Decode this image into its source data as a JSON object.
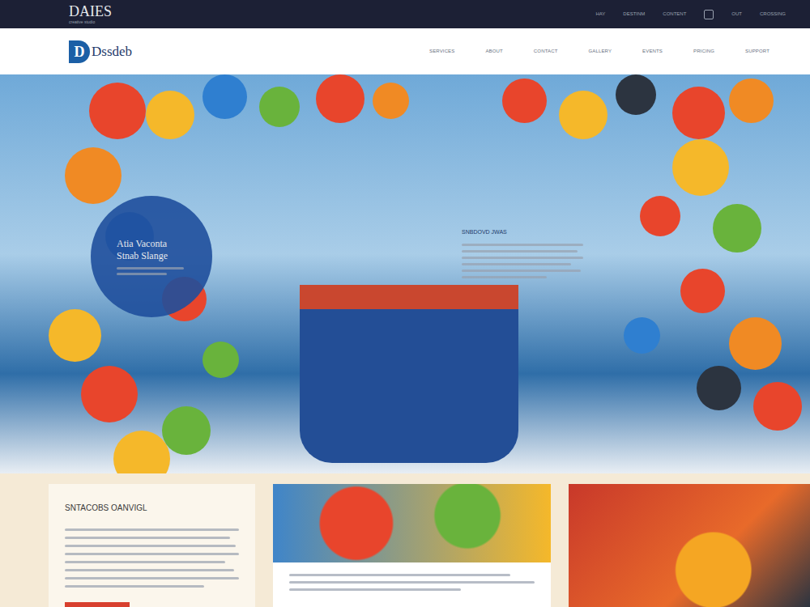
{
  "topbar": {
    "brand": "DAIES",
    "tagline": "creative studio",
    "links": [
      "HAY",
      "DESTINM",
      "CONTENT",
      "OUT",
      "CROSSING"
    ]
  },
  "header": {
    "logo_text": "Dssdeb",
    "logo_mark": "D",
    "nav": [
      "SERVICES",
      "ABOUT",
      "CONTACT",
      "GALLERY",
      "EVENTS",
      "PRICING",
      "SUPPORT"
    ]
  },
  "hero": {
    "badge_title": "Atia Vaconta",
    "badge_subtitle": "Stnab Slange",
    "heading": "SNBDOVD JWAS"
  },
  "cards": [
    {
      "heading": "SNTACOBS OANVIGL"
    }
  ]
}
